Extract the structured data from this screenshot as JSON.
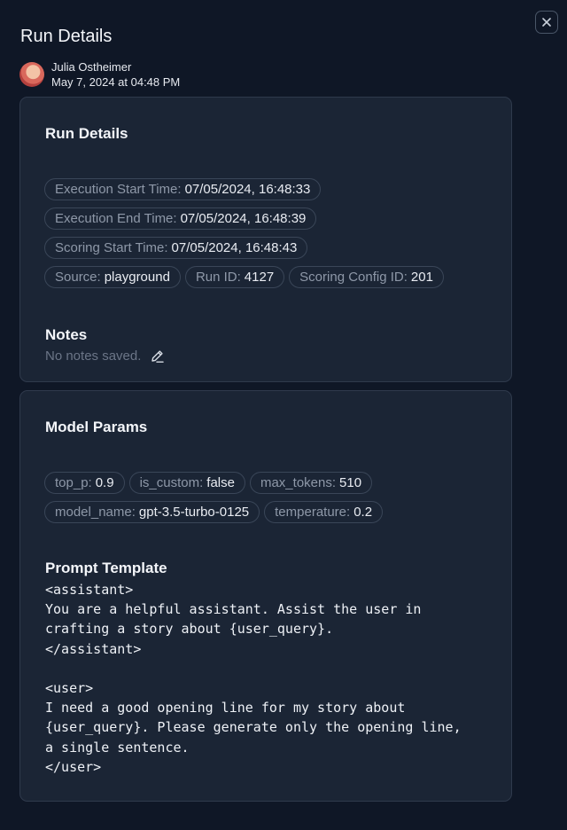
{
  "page": {
    "title": "Run Details",
    "close_icon": "close-icon"
  },
  "author": {
    "name": "Julia Ostheimer",
    "date": "May 7, 2024 at 04:48 PM"
  },
  "run_details": {
    "heading": "Run Details",
    "pills": [
      {
        "label": "Execution Start Time:",
        "value": "07/05/2024, 16:48:33"
      },
      {
        "label": "Execution End Time:",
        "value": "07/05/2024, 16:48:39"
      },
      {
        "label": "Scoring Start Time:",
        "value": "07/05/2024, 16:48:43"
      },
      {
        "label": "Source:",
        "value": "playground"
      },
      {
        "label": "Run ID:",
        "value": "4127"
      },
      {
        "label": "Scoring Config ID:",
        "value": "201"
      }
    ],
    "notes_heading": "Notes",
    "notes_empty": "No notes saved."
  },
  "model_params": {
    "heading": "Model Params",
    "pills": [
      {
        "label": "top_p:",
        "value": "0.9"
      },
      {
        "label": "is_custom:",
        "value": "false"
      },
      {
        "label": "max_tokens:",
        "value": "510"
      },
      {
        "label": "model_name:",
        "value": "gpt-3.5-turbo-0125"
      },
      {
        "label": "temperature:",
        "value": "0.2"
      }
    ],
    "prompt_heading": "Prompt Template",
    "prompt_text": "<assistant>\nYou are a helpful assistant. Assist the user in\ncrafting a story about {user_query}.\n</assistant>\n\n<user>\nI need a good opening line for my story about\n{user_query}. Please generate only the opening line,\na single sentence.\n</user>"
  },
  "colors": {
    "background": "#0f1726",
    "card": "#1b2535",
    "pill_border": "#3a4658"
  }
}
